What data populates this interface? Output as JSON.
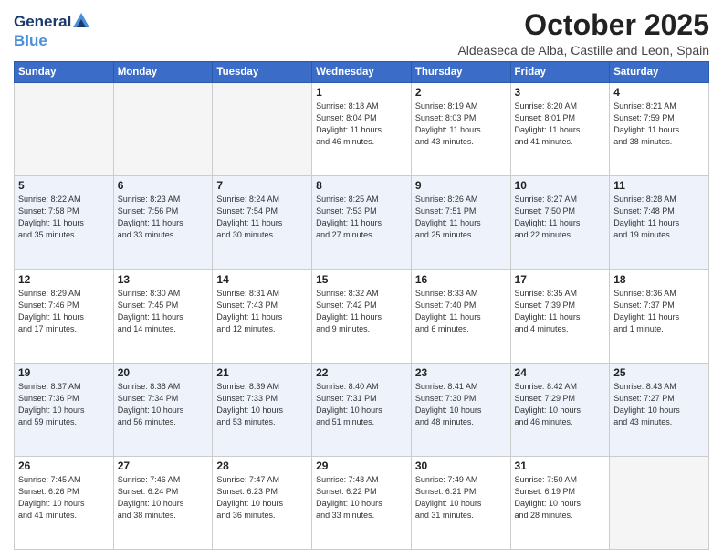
{
  "logo": {
    "line1": "General",
    "line2": "Blue"
  },
  "title": "October 2025",
  "location": "Aldeaseca de Alba, Castille and Leon, Spain",
  "weekdays": [
    "Sunday",
    "Monday",
    "Tuesday",
    "Wednesday",
    "Thursday",
    "Friday",
    "Saturday"
  ],
  "weeks": [
    [
      {
        "day": "",
        "info": ""
      },
      {
        "day": "",
        "info": ""
      },
      {
        "day": "",
        "info": ""
      },
      {
        "day": "1",
        "info": "Sunrise: 8:18 AM\nSunset: 8:04 PM\nDaylight: 11 hours\nand 46 minutes."
      },
      {
        "day": "2",
        "info": "Sunrise: 8:19 AM\nSunset: 8:03 PM\nDaylight: 11 hours\nand 43 minutes."
      },
      {
        "day": "3",
        "info": "Sunrise: 8:20 AM\nSunset: 8:01 PM\nDaylight: 11 hours\nand 41 minutes."
      },
      {
        "day": "4",
        "info": "Sunrise: 8:21 AM\nSunset: 7:59 PM\nDaylight: 11 hours\nand 38 minutes."
      }
    ],
    [
      {
        "day": "5",
        "info": "Sunrise: 8:22 AM\nSunset: 7:58 PM\nDaylight: 11 hours\nand 35 minutes."
      },
      {
        "day": "6",
        "info": "Sunrise: 8:23 AM\nSunset: 7:56 PM\nDaylight: 11 hours\nand 33 minutes."
      },
      {
        "day": "7",
        "info": "Sunrise: 8:24 AM\nSunset: 7:54 PM\nDaylight: 11 hours\nand 30 minutes."
      },
      {
        "day": "8",
        "info": "Sunrise: 8:25 AM\nSunset: 7:53 PM\nDaylight: 11 hours\nand 27 minutes."
      },
      {
        "day": "9",
        "info": "Sunrise: 8:26 AM\nSunset: 7:51 PM\nDaylight: 11 hours\nand 25 minutes."
      },
      {
        "day": "10",
        "info": "Sunrise: 8:27 AM\nSunset: 7:50 PM\nDaylight: 11 hours\nand 22 minutes."
      },
      {
        "day": "11",
        "info": "Sunrise: 8:28 AM\nSunset: 7:48 PM\nDaylight: 11 hours\nand 19 minutes."
      }
    ],
    [
      {
        "day": "12",
        "info": "Sunrise: 8:29 AM\nSunset: 7:46 PM\nDaylight: 11 hours\nand 17 minutes."
      },
      {
        "day": "13",
        "info": "Sunrise: 8:30 AM\nSunset: 7:45 PM\nDaylight: 11 hours\nand 14 minutes."
      },
      {
        "day": "14",
        "info": "Sunrise: 8:31 AM\nSunset: 7:43 PM\nDaylight: 11 hours\nand 12 minutes."
      },
      {
        "day": "15",
        "info": "Sunrise: 8:32 AM\nSunset: 7:42 PM\nDaylight: 11 hours\nand 9 minutes."
      },
      {
        "day": "16",
        "info": "Sunrise: 8:33 AM\nSunset: 7:40 PM\nDaylight: 11 hours\nand 6 minutes."
      },
      {
        "day": "17",
        "info": "Sunrise: 8:35 AM\nSunset: 7:39 PM\nDaylight: 11 hours\nand 4 minutes."
      },
      {
        "day": "18",
        "info": "Sunrise: 8:36 AM\nSunset: 7:37 PM\nDaylight: 11 hours\nand 1 minute."
      }
    ],
    [
      {
        "day": "19",
        "info": "Sunrise: 8:37 AM\nSunset: 7:36 PM\nDaylight: 10 hours\nand 59 minutes."
      },
      {
        "day": "20",
        "info": "Sunrise: 8:38 AM\nSunset: 7:34 PM\nDaylight: 10 hours\nand 56 minutes."
      },
      {
        "day": "21",
        "info": "Sunrise: 8:39 AM\nSunset: 7:33 PM\nDaylight: 10 hours\nand 53 minutes."
      },
      {
        "day": "22",
        "info": "Sunrise: 8:40 AM\nSunset: 7:31 PM\nDaylight: 10 hours\nand 51 minutes."
      },
      {
        "day": "23",
        "info": "Sunrise: 8:41 AM\nSunset: 7:30 PM\nDaylight: 10 hours\nand 48 minutes."
      },
      {
        "day": "24",
        "info": "Sunrise: 8:42 AM\nSunset: 7:29 PM\nDaylight: 10 hours\nand 46 minutes."
      },
      {
        "day": "25",
        "info": "Sunrise: 8:43 AM\nSunset: 7:27 PM\nDaylight: 10 hours\nand 43 minutes."
      }
    ],
    [
      {
        "day": "26",
        "info": "Sunrise: 7:45 AM\nSunset: 6:26 PM\nDaylight: 10 hours\nand 41 minutes."
      },
      {
        "day": "27",
        "info": "Sunrise: 7:46 AM\nSunset: 6:24 PM\nDaylight: 10 hours\nand 38 minutes."
      },
      {
        "day": "28",
        "info": "Sunrise: 7:47 AM\nSunset: 6:23 PM\nDaylight: 10 hours\nand 36 minutes."
      },
      {
        "day": "29",
        "info": "Sunrise: 7:48 AM\nSunset: 6:22 PM\nDaylight: 10 hours\nand 33 minutes."
      },
      {
        "day": "30",
        "info": "Sunrise: 7:49 AM\nSunset: 6:21 PM\nDaylight: 10 hours\nand 31 minutes."
      },
      {
        "day": "31",
        "info": "Sunrise: 7:50 AM\nSunset: 6:19 PM\nDaylight: 10 hours\nand 28 minutes."
      },
      {
        "day": "",
        "info": ""
      }
    ]
  ],
  "alt_rows": [
    1,
    3
  ],
  "colors": {
    "header_bg": "#3a6cc8",
    "alt_row_bg": "#eef2fb",
    "empty_bg": "#f5f5f5"
  }
}
